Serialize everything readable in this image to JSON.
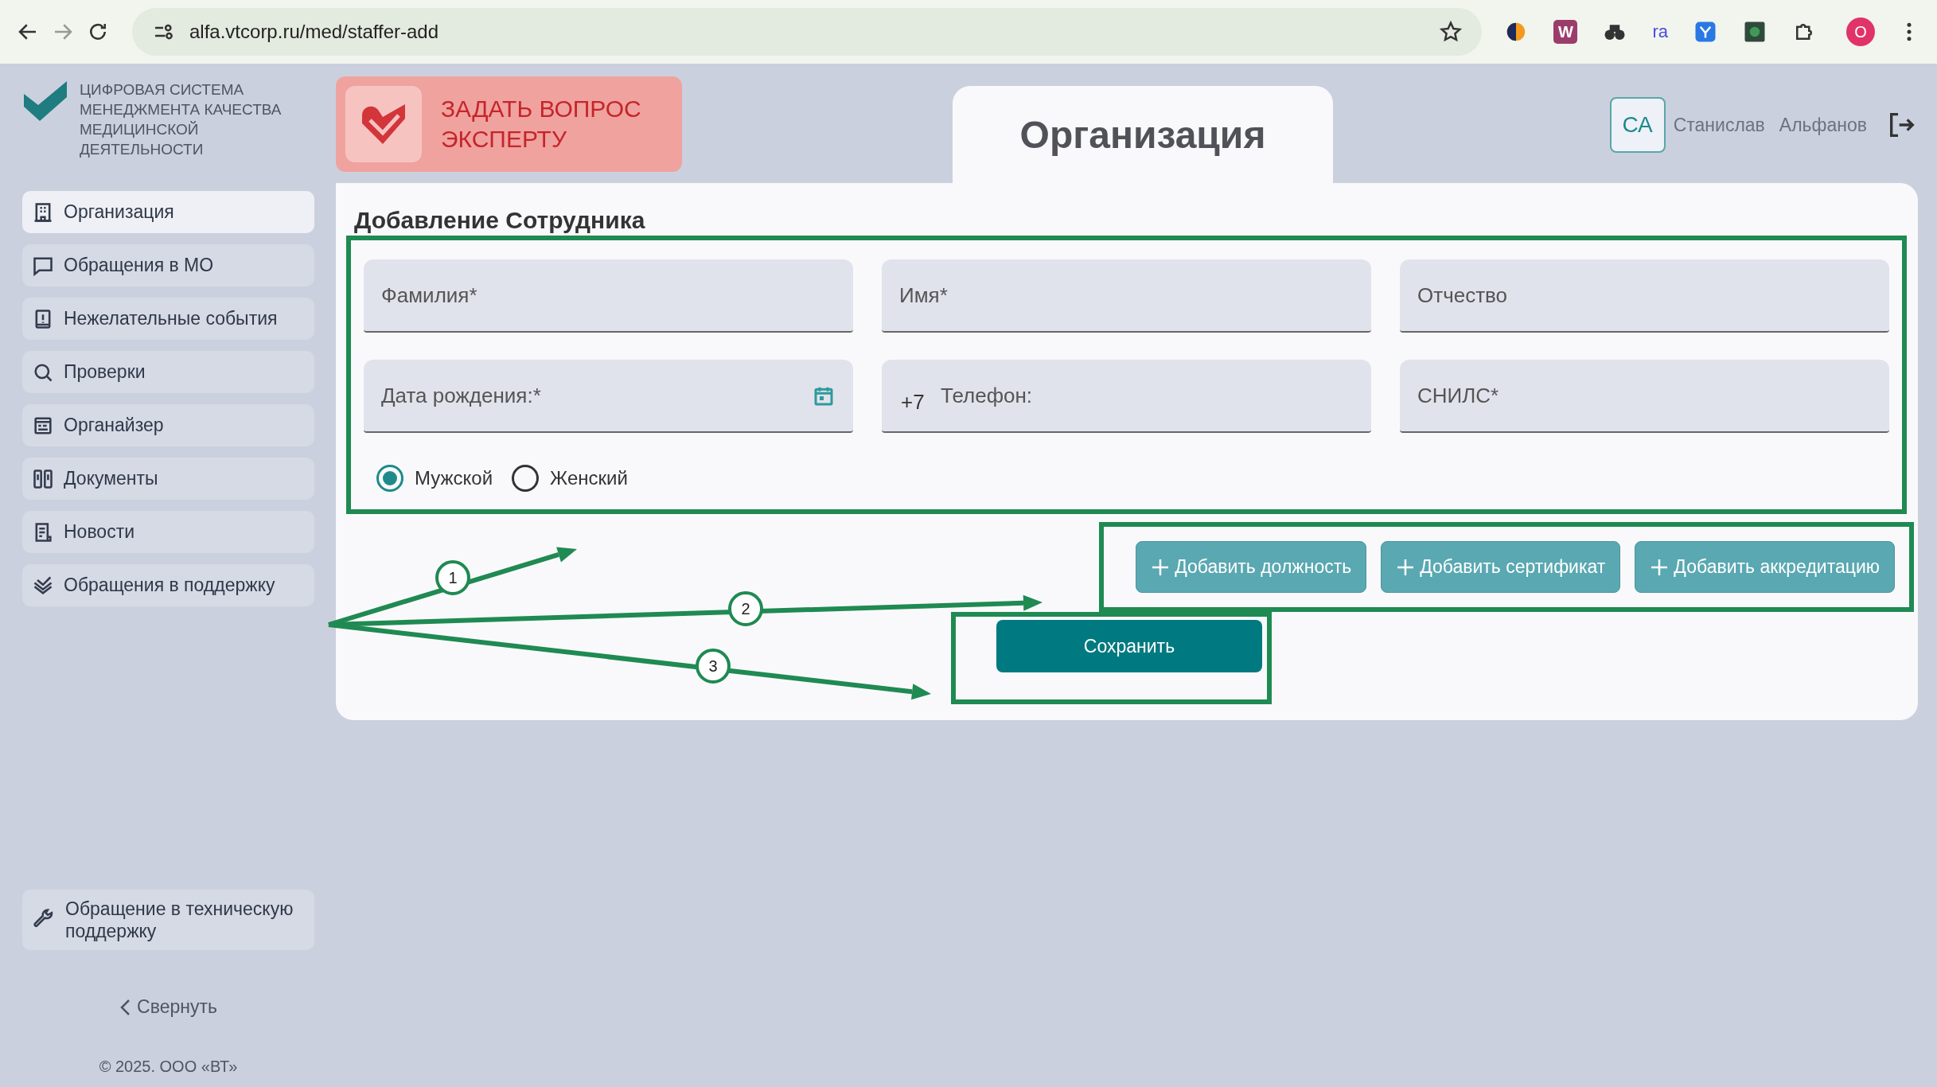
{
  "browser": {
    "url": "alfa.vtcorp.ru/med/staffer-add",
    "extension_labels": [
      "W",
      "ra"
    ],
    "profile_initial": "O"
  },
  "logo": {
    "text": "ЦИФРОВАЯ СИСТЕМА МЕНЕДЖМЕНТА КАЧЕСТВА МЕДИЦИНСКОЙ ДЕЯТЕЛЬНОСТИ"
  },
  "ask_expert": {
    "label": "ЗАДАТЬ ВОПРОС ЭКСПЕРТУ"
  },
  "page_tab": {
    "title": "Организация"
  },
  "user": {
    "initials": "СА",
    "first_name": "Станислав",
    "last_name": "Альфанов"
  },
  "sidebar": {
    "items": [
      {
        "label": "Организация",
        "selected": true
      },
      {
        "label": "Обращения в МО",
        "selected": false
      },
      {
        "label": "Нежелательные события",
        "selected": false
      },
      {
        "label": "Проверки",
        "selected": false
      },
      {
        "label": "Органайзер",
        "selected": false
      },
      {
        "label": "Документы",
        "selected": false
      },
      {
        "label": "Новости",
        "selected": false
      },
      {
        "label": "Обращения в поддержку",
        "selected": false
      }
    ],
    "support": "Обращение в техническую поддержку",
    "collapse": "Свернуть",
    "copyright": "© 2025. ООО «ВТ»"
  },
  "form": {
    "title": "Добавление Сотрудника",
    "fields": [
      {
        "kind": "text",
        "placeholder": "Фамилия*"
      },
      {
        "kind": "text",
        "placeholder": "Имя*"
      },
      {
        "kind": "text",
        "placeholder": "Отчество"
      },
      {
        "kind": "date",
        "placeholder": "Дата рождения:*"
      },
      {
        "kind": "phone",
        "prefix": "+7",
        "placeholder": "Телефон:"
      },
      {
        "kind": "text",
        "placeholder": "СНИЛС*"
      }
    ],
    "gender": [
      {
        "label": "Мужской",
        "selected": true
      },
      {
        "label": "Женский",
        "selected": false
      }
    ],
    "add_buttons": [
      "Добавить должность",
      "Добавить сертификат",
      "Добавить аккредитацию"
    ],
    "save": "Сохранить"
  },
  "annotations": [
    "1",
    "2",
    "3"
  ]
}
